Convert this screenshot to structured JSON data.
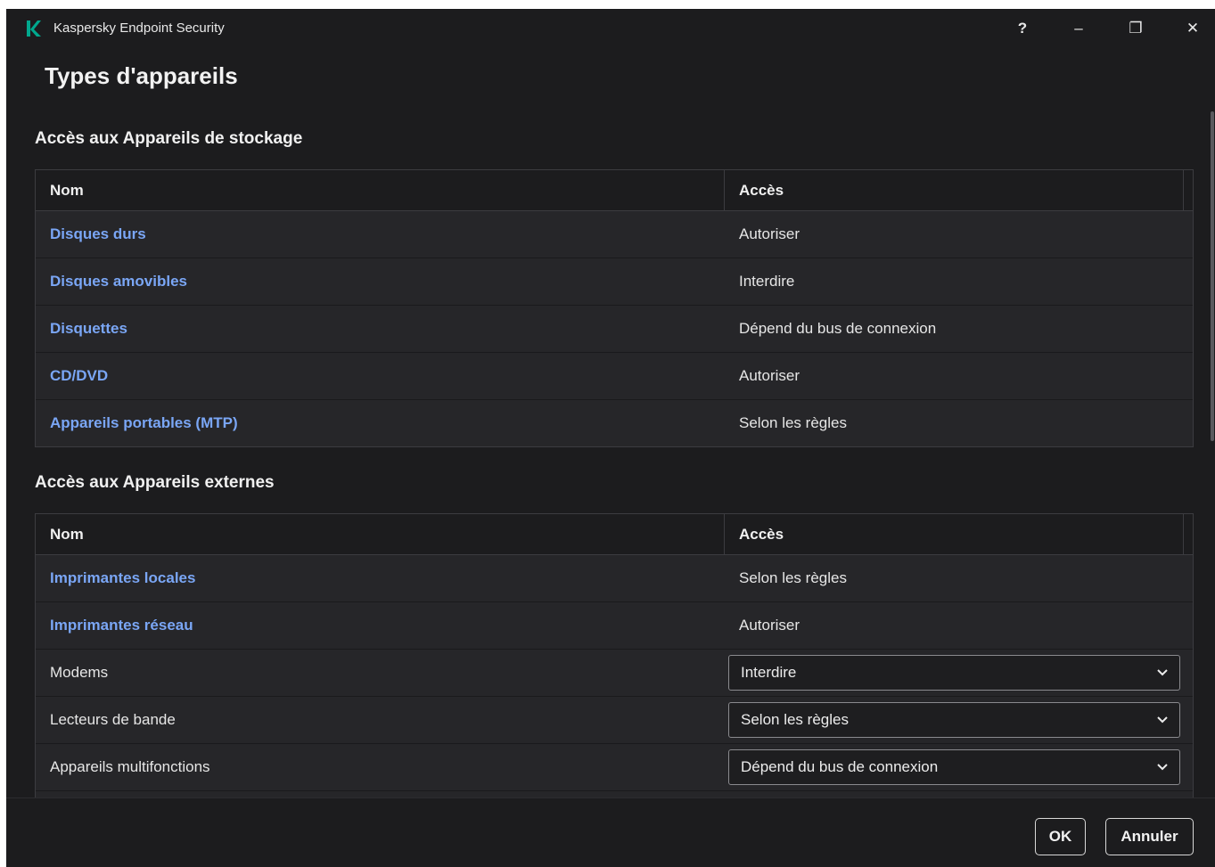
{
  "app": {
    "title": "Kaspersky Endpoint Security",
    "brand_color": "#00a88e"
  },
  "window_controls": {
    "help": "?",
    "minimize": "–",
    "restore": "❐",
    "close": "✕"
  },
  "page": {
    "title": "Types d'appareils"
  },
  "storage": {
    "title": "Accès aux Appareils de stockage",
    "col_name": "Nom",
    "col_access": "Accès",
    "rows": [
      {
        "name": "Disques durs",
        "access": "Autoriser"
      },
      {
        "name": "Disques amovibles",
        "access": "Interdire"
      },
      {
        "name": "Disquettes",
        "access": "Dépend du bus de connexion"
      },
      {
        "name": "CD/DVD",
        "access": "Autoriser"
      },
      {
        "name": "Appareils portables (MTP)",
        "access": "Selon les règles"
      }
    ]
  },
  "external": {
    "title": "Accès aux Appareils externes",
    "col_name": "Nom",
    "col_access": "Accès",
    "rows": [
      {
        "name": "Imprimantes locales",
        "access": "Selon les règles"
      },
      {
        "name": "Imprimantes réseau",
        "access": "Autoriser"
      },
      {
        "name": "Modems",
        "access": "Interdire"
      },
      {
        "name": "Lecteurs de bande",
        "access": "Selon les règles"
      },
      {
        "name": "Appareils multifonctions",
        "access": "Dépend du bus de connexion"
      }
    ]
  },
  "footer": {
    "ok": "OK",
    "cancel": "Annuler"
  },
  "colors": {
    "link": "#7aa6f5",
    "background": "#1c1c1e",
    "row": "#262629"
  }
}
